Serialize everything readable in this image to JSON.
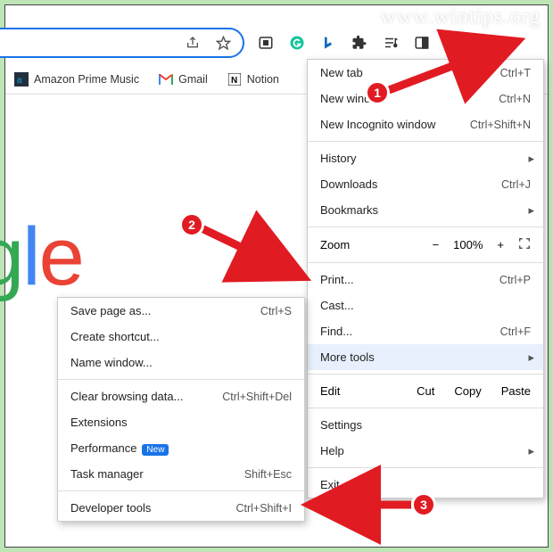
{
  "watermark": "www.wintips.org",
  "toolbar": {
    "share_icon": "↗",
    "star_icon": "☆",
    "ext_icons": [
      "reader",
      "grammarly",
      "bing",
      "extensions",
      "music",
      "sidepanel"
    ]
  },
  "bookmarks": [
    {
      "icon": "apm",
      "label": "Amazon Prime Music"
    },
    {
      "icon": "gmail",
      "label": "Gmail"
    },
    {
      "icon": "notion",
      "label": "Notion"
    }
  ],
  "logo_letters": [
    "g",
    "l",
    "e"
  ],
  "mainmenu": {
    "new_tab": "New tab",
    "new_tab_sc": "Ctrl+T",
    "new_window": "New window",
    "new_window_sc": "Ctrl+N",
    "incognito": "New Incognito window",
    "incognito_sc": "Ctrl+Shift+N",
    "history": "History",
    "downloads": "Downloads",
    "downloads_sc": "Ctrl+J",
    "bookmarks": "Bookmarks",
    "zoom_label": "Zoom",
    "zoom_value": "100%",
    "print": "Print...",
    "print_sc": "Ctrl+P",
    "cast": "Cast...",
    "find": "Find...",
    "find_sc": "Ctrl+F",
    "more_tools": "More tools",
    "edit": "Edit",
    "cut": "Cut",
    "copy": "Copy",
    "paste": "Paste",
    "settings": "Settings",
    "help": "Help",
    "exit": "Exit"
  },
  "submenu": {
    "save_page": "Save page as...",
    "save_page_sc": "Ctrl+S",
    "create_shortcut": "Create shortcut...",
    "name_window": "Name window...",
    "clear_browsing": "Clear browsing data...",
    "clear_browsing_sc": "Ctrl+Shift+Del",
    "extensions": "Extensions",
    "performance": "Performance",
    "new_badge": "New",
    "task_manager": "Task manager",
    "task_manager_sc": "Shift+Esc",
    "dev_tools": "Developer tools",
    "dev_tools_sc": "Ctrl+Shift+I"
  },
  "callouts": {
    "c1": "1",
    "c2": "2",
    "c3": "3"
  }
}
